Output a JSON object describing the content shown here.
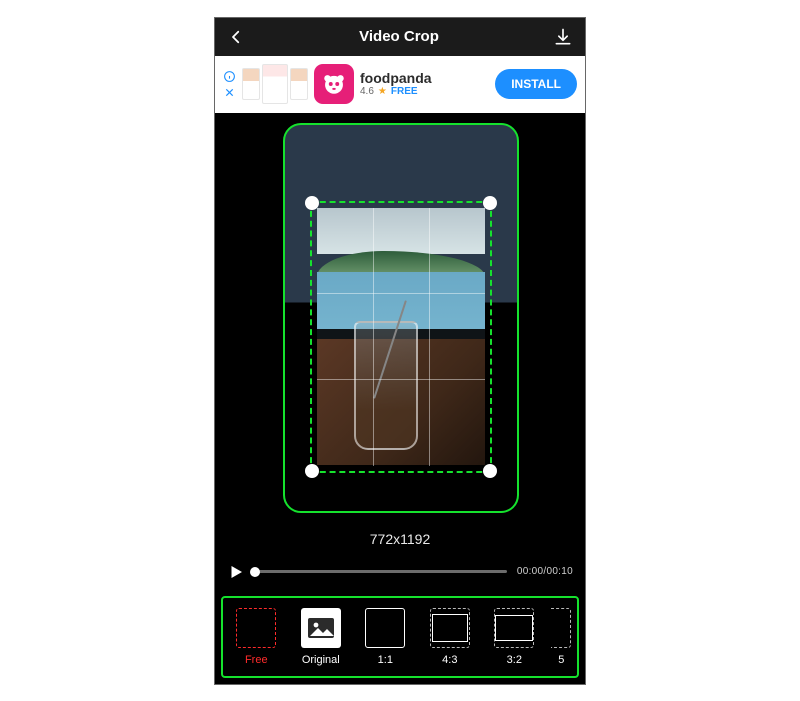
{
  "header": {
    "title": "Video Crop"
  },
  "ad": {
    "name": "foodpanda",
    "rating": "4.6",
    "price_label": "FREE",
    "install_label": "INSTALL"
  },
  "crop": {
    "dimensions_label": "772x1192"
  },
  "playback": {
    "time_label": "00:00/00:10"
  },
  "aspect_options": [
    {
      "label": "Free"
    },
    {
      "label": "Original"
    },
    {
      "label": "1:1"
    },
    {
      "label": "4:3"
    },
    {
      "label": "3:2"
    },
    {
      "label": "5"
    }
  ],
  "colors": {
    "accent": "#15e22d",
    "warn": "#ff2b2b",
    "link": "#1d8fff"
  }
}
